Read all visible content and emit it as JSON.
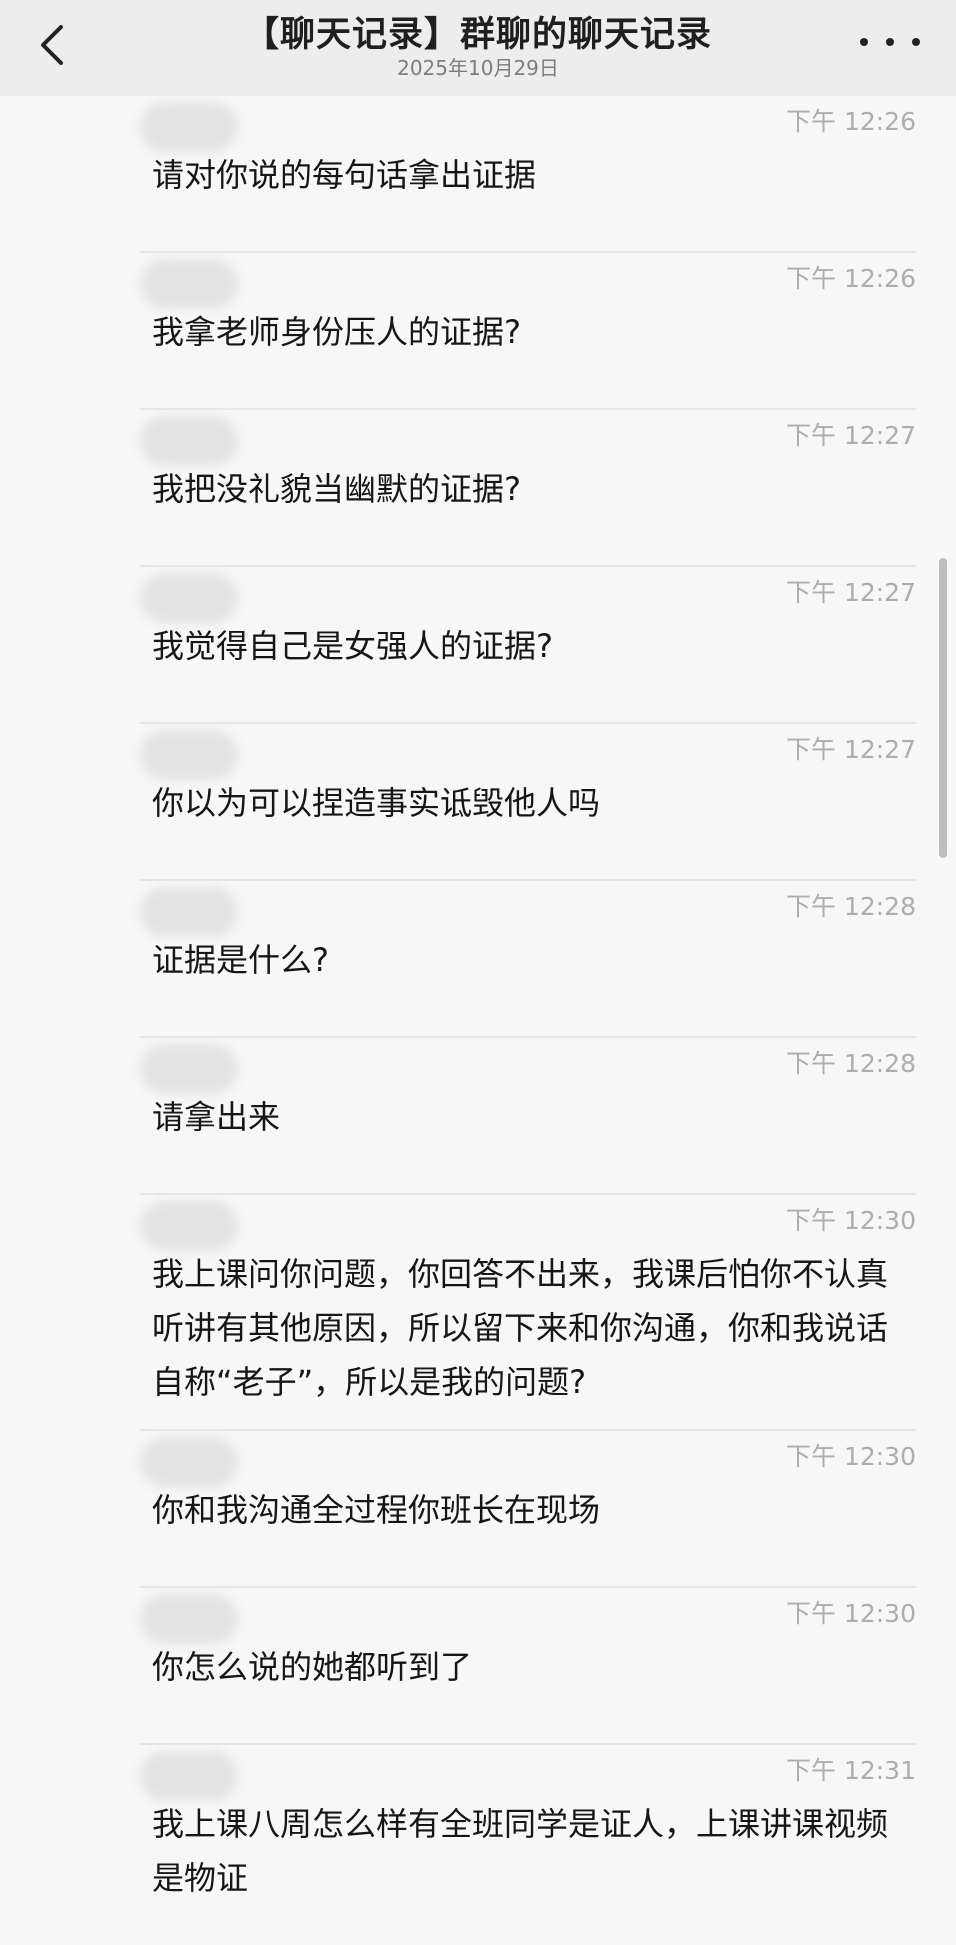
{
  "header": {
    "title": "【聊天记录】群聊的聊天记录",
    "date": "2025年10月29日",
    "back_icon": "chevron-left-icon",
    "more_icon": "more-dots-icon"
  },
  "messages": [
    {
      "time": "下午 12:26",
      "text": "请对你说的每句话拿出证据"
    },
    {
      "time": "下午 12:26",
      "text": "我拿老师身份压人的证据?"
    },
    {
      "time": "下午 12:27",
      "text": "我把没礼貌当幽默的证据?"
    },
    {
      "time": "下午 12:27",
      "text": "我觉得自己是女强人的证据?"
    },
    {
      "time": "下午 12:27",
      "text": "你以为可以捏造事实诋毁他人吗"
    },
    {
      "time": "下午 12:28",
      "text": "证据是什么?"
    },
    {
      "time": "下午 12:28",
      "text": "请拿出来"
    },
    {
      "time": "下午 12:30",
      "text": "我上课问你问题，你回答不出来，我课后怕你不认真听讲有其他原因，所以留下来和你沟通，你和我说话自称“老子”，所以是我的问题?"
    },
    {
      "time": "下午 12:30",
      "text": "你和我沟通全过程你班长在现场"
    },
    {
      "time": "下午 12:30",
      "text": "你怎么说的她都听到了"
    },
    {
      "time": "下午 12:31",
      "text": "我上课八周怎么样有全班同学是证人，上课讲课视频是物证"
    }
  ]
}
